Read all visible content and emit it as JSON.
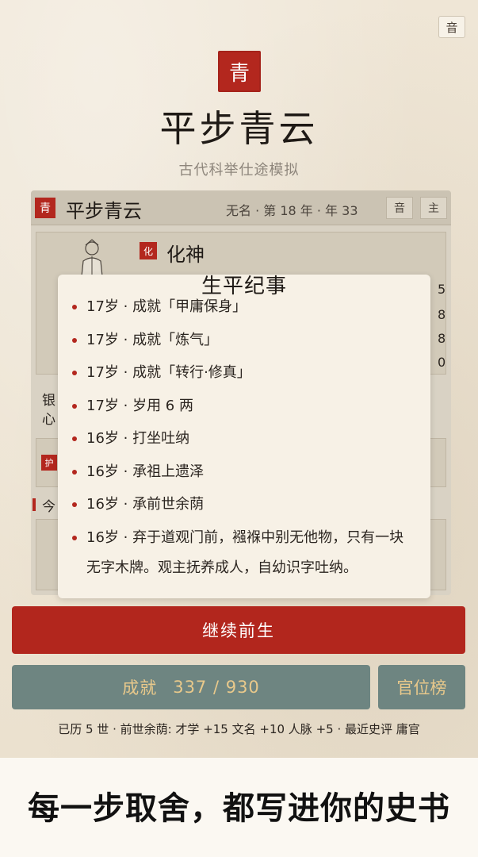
{
  "header": {
    "sound_button": "音",
    "seal_char": "青",
    "title": "平步青云",
    "subtitle": "古代科举仕途模拟"
  },
  "game_panel": {
    "seal_char": "青",
    "title": "平步青云",
    "status": "无名 · 第 18 年 · 年 33",
    "buttons": [
      "音",
      "主"
    ],
    "realm_tag": "化",
    "realm": "化神",
    "side_numbers": [
      "5",
      "8",
      "8",
      "0"
    ],
    "side_labels": [
      "银",
      "心"
    ],
    "tag_label": "护",
    "today_label": "今"
  },
  "modal": {
    "title": "生平纪事",
    "events": [
      "17岁 · 成就「甲庸保身」",
      "17岁 · 成就「炼气」",
      "17岁 · 成就「转行·修真」",
      "17岁 · 岁用 6 两",
      "16岁 · 打坐吐纳",
      "16岁 · 承祖上遗泽",
      "16岁 · 承前世余荫",
      "16岁 · 弃于道观门前，襁褓中别无他物，只有一块无字木牌。观主抚养成人，自幼识字吐纳。"
    ]
  },
  "controls": {
    "continue_label": "继续前生",
    "achievements_label": "成就",
    "achievements_value": "337 / 930",
    "rank_label": "官位榜"
  },
  "stats_line": "已历 5 世 · 前世余荫: 才学 +15 文名 +10 人脉 +5 · 最近史评 庸官",
  "slogan": "每一步取舍，都写进你的史书",
  "colors": {
    "accent_red": "#b3271e",
    "teal_button": "#6e8581",
    "gold_text": "#e9c98b",
    "paper": "#efe6d6"
  }
}
